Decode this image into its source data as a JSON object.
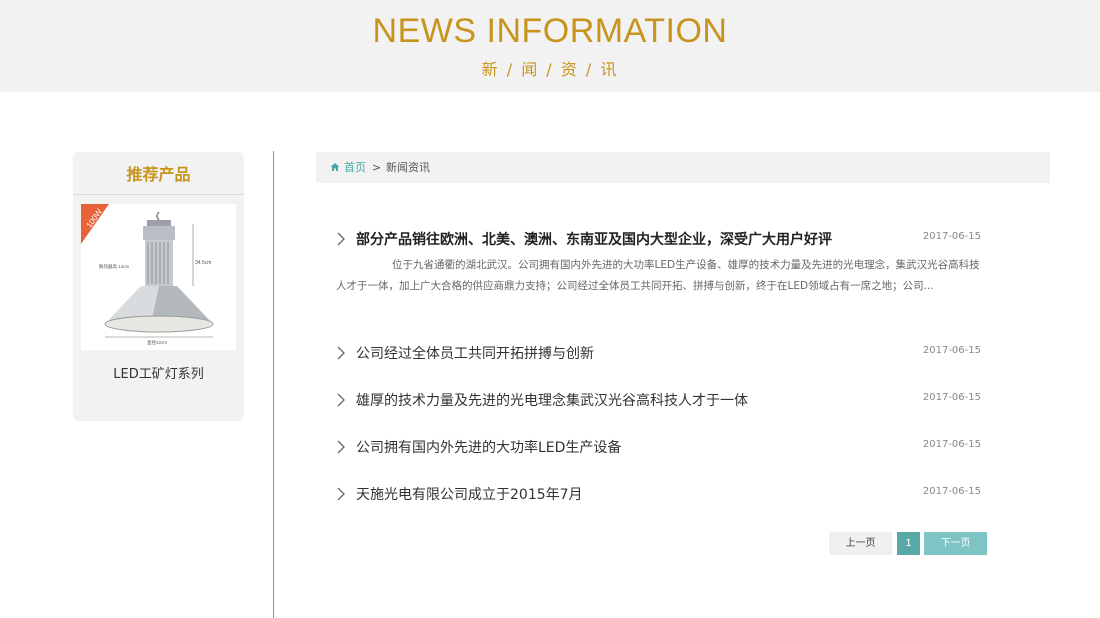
{
  "hero": {
    "title": "NEWS INFORMATION",
    "subtitle": "新 / 闻 / 资 / 讯"
  },
  "sidebar": {
    "heading": "推荐产品",
    "product": {
      "name": "LED工矿灯系列",
      "image_badge": "100W",
      "image_label_height": "34.5cm",
      "image_label_fin": "散热器高 14cm",
      "image_label_diameter": "直径42cm"
    }
  },
  "breadcrumb": {
    "home": "首页",
    "separator": ">",
    "current": "新闻资讯"
  },
  "news": [
    {
      "title": "部分产品销往欧洲、北美、澳洲、东南亚及国内大型企业，深受广大用户好评",
      "date": "2017-06-15",
      "excerpt": "位于九省通衢的湖北武汉。公司拥有国内外先进的大功率LED生产设备、雄厚的技术力量及先进的光电理念，集武汉光谷高科技人才于一体，加上广大合格的供应商鼎力支持；公司经过全体员工共同开拓、拼搏与创新，终于在LED领域占有一席之地；公司..."
    },
    {
      "title": "公司经过全体员工共同开拓拼搏与创新",
      "date": "2017-06-15"
    },
    {
      "title": "雄厚的技术力量及先进的光电理念集武汉光谷高科技人才于一体",
      "date": "2017-06-15"
    },
    {
      "title": "公司拥有国内外先进的大功率LED生产设备",
      "date": "2017-06-15"
    },
    {
      "title": "天施光电有限公司成立于2015年7月",
      "date": "2017-06-15"
    }
  ],
  "pagination": {
    "prev": "上一页",
    "current": "1",
    "next": "下一页"
  },
  "colors": {
    "accent_gold": "#c8941b",
    "teal": "#5aa9a9",
    "panel_gray": "#f2f2f2"
  }
}
